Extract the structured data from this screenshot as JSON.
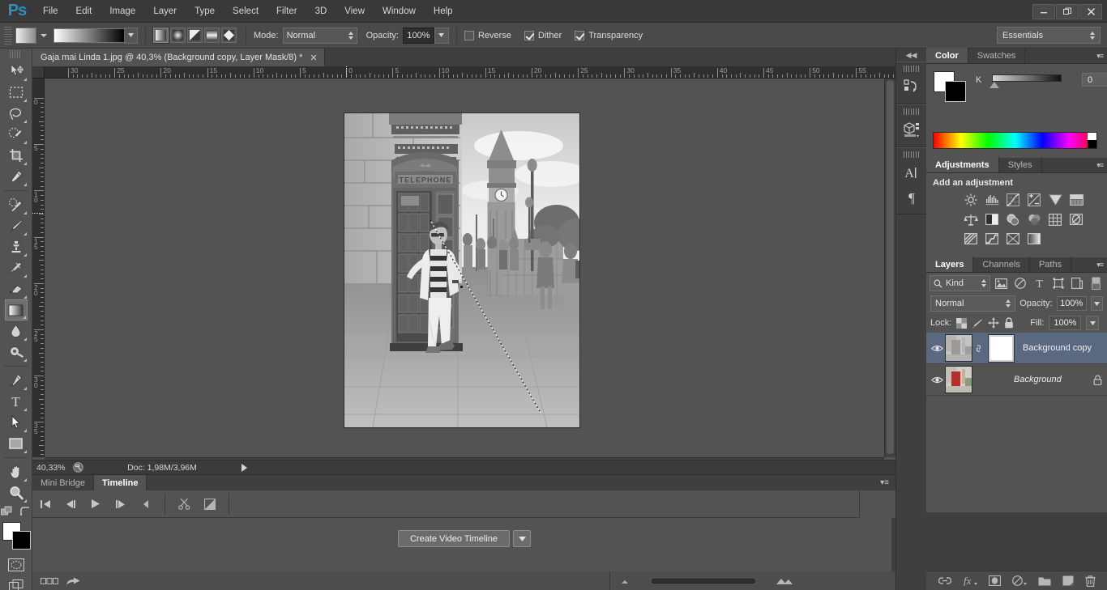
{
  "app": {
    "name": "Adobe Photoshop",
    "logo_text": "Ps"
  },
  "menubar": {
    "items": [
      {
        "label": "File"
      },
      {
        "label": "Edit"
      },
      {
        "label": "Image"
      },
      {
        "label": "Layer"
      },
      {
        "label": "Type"
      },
      {
        "label": "Select"
      },
      {
        "label": "Filter"
      },
      {
        "label": "3D"
      },
      {
        "label": "View"
      },
      {
        "label": "Window"
      },
      {
        "label": "Help"
      }
    ],
    "window_controls": {
      "minimize": "─",
      "restore": "❐",
      "close": "✕"
    }
  },
  "options_bar": {
    "tool": "gradient-tool",
    "gradient_types": [
      "linear-gradient",
      "radial-gradient",
      "angle-gradient",
      "reflected-gradient",
      "diamond-gradient"
    ],
    "selected_gradient_type": 0,
    "mode_label": "Mode:",
    "mode_value": "Normal",
    "opacity_label": "Opacity:",
    "opacity_value": "100%",
    "reverse_label": "Reverse",
    "reverse_checked": false,
    "dither_label": "Dither",
    "dither_checked": true,
    "transparency_label": "Transparency",
    "transparency_checked": true,
    "workspace": "Essentials"
  },
  "toolbar": {
    "tools": [
      {
        "name": "move-tool"
      },
      {
        "name": "rectangular-marquee-tool"
      },
      {
        "name": "lasso-tool"
      },
      {
        "name": "quick-selection-tool"
      },
      {
        "name": "crop-tool"
      },
      {
        "name": "eyedropper-tool"
      },
      {
        "name": "spot-healing-brush-tool"
      },
      {
        "name": "brush-tool"
      },
      {
        "name": "clone-stamp-tool"
      },
      {
        "name": "history-brush-tool"
      },
      {
        "name": "eraser-tool"
      },
      {
        "name": "gradient-tool"
      },
      {
        "name": "blur-tool"
      },
      {
        "name": "dodge-tool"
      },
      {
        "name": "pen-tool"
      },
      {
        "name": "horizontal-type-tool"
      },
      {
        "name": "path-selection-tool"
      },
      {
        "name": "rectangle-tool"
      },
      {
        "name": "hand-tool"
      },
      {
        "name": "zoom-tool"
      },
      {
        "name": "edit-toolbar"
      }
    ],
    "active_tool": "gradient-tool",
    "foreground_color": "#ffffff",
    "background_color": "#000000"
  },
  "document": {
    "tab_title": "Gaja mai Linda 1.jpg @ 40,3% (Background copy, Layer Mask/8) *",
    "close_glyph": "✕",
    "zoom_level": "40,33%",
    "doc_info": "Doc: 1,98M/3,96M"
  },
  "rulers": {
    "horizontal_labels": [
      "30",
      "25",
      "20",
      "15",
      "10",
      "5",
      "0",
      "5",
      "10",
      "15",
      "20",
      "25",
      "30",
      "35",
      "40",
      "45",
      "50",
      "55"
    ],
    "vertical_labels": [
      "0",
      "5",
      "10",
      "15",
      "20",
      "25",
      "30",
      "35"
    ],
    "units": "cm"
  },
  "canvas": {
    "photo_description": "Black and white photo of a person leaning on a red London telephone box with Big Ben in background",
    "gradient_line_visible": true
  },
  "right_dock": {
    "collapse_glyph": "◀◀",
    "buttons": [
      {
        "name": "history-panel-icon"
      },
      {
        "name": "3d-panel-icon"
      },
      {
        "name": "character-panel-icon"
      },
      {
        "name": "paragraph-panel-icon"
      }
    ]
  },
  "color_panel": {
    "tabs": [
      {
        "label": "Color",
        "active": true
      },
      {
        "label": "Swatches",
        "active": false
      }
    ],
    "menu_glyph": "▾≡",
    "channel_label": "K",
    "channel_value": "0",
    "percent_label": "%",
    "foreground_color": "#ffffff",
    "background_color": "#000000"
  },
  "adjustments_panel": {
    "tabs": [
      {
        "label": "Adjustments",
        "active": true
      },
      {
        "label": "Styles",
        "active": false
      }
    ],
    "menu_glyph": "▾≡",
    "heading": "Add an adjustment",
    "icons": [
      {
        "name": "brightness-contrast-icon"
      },
      {
        "name": "levels-icon"
      },
      {
        "name": "curves-icon"
      },
      {
        "name": "exposure-icon"
      },
      {
        "name": "vibrance-icon"
      },
      {
        "name": "hue-saturation-icon"
      },
      {
        "name": "color-balance-icon"
      },
      {
        "name": "black-and-white-icon"
      },
      {
        "name": "photo-filter-icon"
      },
      {
        "name": "channel-mixer-icon"
      },
      {
        "name": "color-lookup-icon"
      },
      {
        "name": "invert-icon"
      },
      {
        "name": "posterize-icon"
      },
      {
        "name": "threshold-icon"
      },
      {
        "name": "selective-color-icon"
      },
      {
        "name": "gradient-map-icon"
      }
    ]
  },
  "layers_panel": {
    "tabs": [
      {
        "label": "Layers",
        "active": true
      },
      {
        "label": "Channels",
        "active": false
      },
      {
        "label": "Paths",
        "active": false
      }
    ],
    "menu_glyph": "▾≡",
    "filter_label": "Kind",
    "filter_icons": [
      {
        "name": "filter-pixel-icon"
      },
      {
        "name": "filter-adjustment-icon"
      },
      {
        "name": "filter-type-icon"
      },
      {
        "name": "filter-shape-icon"
      },
      {
        "name": "filter-smart-object-icon"
      },
      {
        "name": "filter-toggle-icon"
      }
    ],
    "blend_mode": "Normal",
    "opacity_label": "Opacity:",
    "opacity_value": "100%",
    "lock_label": "Lock:",
    "lock_icons": [
      {
        "name": "lock-transparent-pixels-icon"
      },
      {
        "name": "lock-image-pixels-icon"
      },
      {
        "name": "lock-position-icon"
      },
      {
        "name": "lock-all-icon"
      }
    ],
    "fill_label": "Fill:",
    "fill_value": "100%",
    "layers": [
      {
        "name": "Background copy",
        "visible": true,
        "selected": true,
        "has_mask": true,
        "linked": true,
        "italic": false,
        "locked": false
      },
      {
        "name": "Background",
        "visible": true,
        "selected": false,
        "has_mask": false,
        "linked": false,
        "italic": true,
        "locked": true
      }
    ],
    "footer_buttons": [
      {
        "name": "link-layers-icon",
        "glyph": "⚭"
      },
      {
        "name": "layer-style-fx-icon",
        "glyph": "fx"
      },
      {
        "name": "add-layer-mask-icon",
        "glyph": "▣"
      },
      {
        "name": "new-fill-adjustment-layer-icon",
        "glyph": "◑"
      },
      {
        "name": "new-group-icon",
        "glyph": "▱"
      },
      {
        "name": "new-layer-icon",
        "glyph": "◱"
      },
      {
        "name": "delete-layer-icon",
        "glyph": "Ὕ1"
      }
    ]
  },
  "bottom_panel": {
    "tabs": [
      {
        "label": "Mini Bridge",
        "active": false
      },
      {
        "label": "Timeline",
        "active": true
      }
    ],
    "menu_glyph": "▾≡",
    "transport": [
      {
        "name": "go-to-first-frame-button"
      },
      {
        "name": "previous-frame-button"
      },
      {
        "name": "play-button"
      },
      {
        "name": "next-frame-button"
      },
      {
        "name": "audio-button"
      },
      {
        "name": "split-at-playhead-button"
      },
      {
        "name": "transition-button"
      }
    ],
    "create_timeline_label": "Create Video Timeline",
    "footer": {
      "frame_mode_icon": "convert-to-frame-animation-icon",
      "share_icon": "render-video-icon",
      "zoom_out_icon": "zoom-out-icon",
      "zoom_in_icon": "zoom-in-icon"
    }
  }
}
